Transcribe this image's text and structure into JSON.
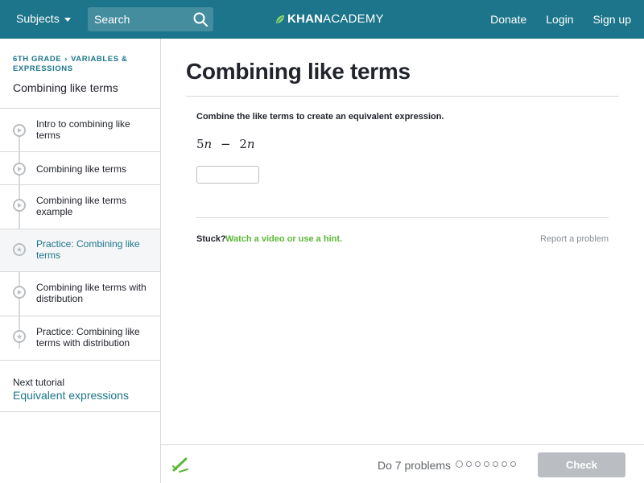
{
  "header": {
    "subjects_label": "Subjects",
    "search_placeholder": "Search",
    "logo_bold": "KHAN",
    "logo_thin": "ACADEMY",
    "links": [
      "Donate",
      "Login",
      "Sign up"
    ],
    "brand_color": "#1c758a"
  },
  "sidebar": {
    "breadcrumb": [
      "6th grade",
      "Variables & expressions"
    ],
    "title": "Combining like terms",
    "items": [
      {
        "label": "Intro to combining like terms",
        "icon": "play-icon",
        "active": false
      },
      {
        "label": "Combining like terms",
        "icon": "play-icon",
        "active": false
      },
      {
        "label": "Combining like terms example",
        "icon": "play-icon",
        "active": false
      },
      {
        "label": "Practice: Combining like terms",
        "icon": "star-icon",
        "active": true
      },
      {
        "label": "Combining like terms with distribution",
        "icon": "play-icon",
        "active": false
      },
      {
        "label": "Practice: Combining like terms with distribution",
        "icon": "star-icon",
        "active": false
      }
    ],
    "next_label": "Next tutorial",
    "next_link": "Equivalent expressions"
  },
  "main": {
    "title": "Combining like terms",
    "prompt": "Combine the like terms to create an equivalent expression.",
    "expression": {
      "c1": "5",
      "v1": "n",
      "op": "−",
      "c2": "2",
      "v2": "n"
    },
    "answer_value": "",
    "stuck_label": "Stuck?",
    "stuck_link": "Watch a video or use a hint.",
    "report_label": "Report a problem"
  },
  "footer": {
    "do_problems": "Do 7 problems",
    "problem_count": 7,
    "check_label": "Check"
  }
}
